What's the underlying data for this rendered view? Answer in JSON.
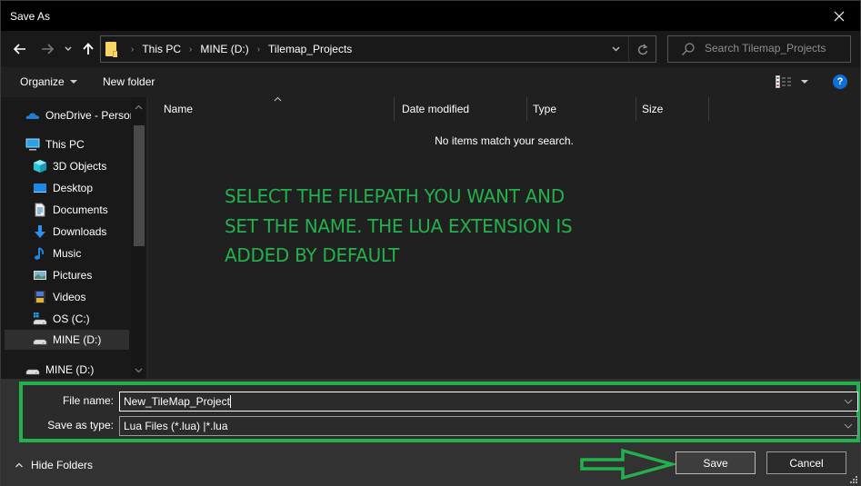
{
  "window": {
    "title": "Save As"
  },
  "nav": {
    "back_icon": "arrow-left-icon",
    "forward_icon": "arrow-right-icon",
    "recent_icon": "chevron-down-icon",
    "up_icon": "arrow-up-icon",
    "breadcrumbs": [
      "This PC",
      "MINE (D:)",
      "Tilemap_Projects"
    ],
    "search_placeholder": "Search Tilemap_Projects"
  },
  "toolbar": {
    "organize_label": "Organize",
    "new_folder_label": "New folder",
    "view_icon": "details-view-icon",
    "help_label": "?"
  },
  "sidebar": {
    "items": [
      {
        "label": "OneDrive - Personal",
        "icon": "onedrive-cloud-icon"
      },
      {
        "label": "This PC",
        "icon": "computer-icon"
      },
      {
        "label": "3D Objects",
        "icon": "3d-objects-icon"
      },
      {
        "label": "Desktop",
        "icon": "desktop-icon"
      },
      {
        "label": "Documents",
        "icon": "documents-icon"
      },
      {
        "label": "Downloads",
        "icon": "downloads-icon"
      },
      {
        "label": "Music",
        "icon": "music-icon"
      },
      {
        "label": "Pictures",
        "icon": "pictures-icon"
      },
      {
        "label": "Videos",
        "icon": "videos-icon"
      },
      {
        "label": "OS (C:)",
        "icon": "drive-c-icon"
      },
      {
        "label": "MINE (D:)",
        "icon": "drive-icon",
        "selected": true
      },
      {
        "label": "MINE (D:)",
        "icon": "drive-icon"
      }
    ]
  },
  "content": {
    "columns": [
      "Name",
      "Date modified",
      "Type",
      "Size"
    ],
    "empty_message": "No items match your search.",
    "annotation_lines": [
      "SELECT THE FILEPATH YOU WANT AND",
      "SET THE NAME. THE LUA EXTENSION IS",
      "ADDED BY DEFAULT"
    ]
  },
  "form": {
    "file_name_label": "File name:",
    "file_name_value": "New_TileMap_Project",
    "save_type_label": "Save as type:",
    "save_type_value": "Lua Files (*.lua) |*.lua"
  },
  "footer": {
    "hide_folders_label": "Hide Folders",
    "save_label": "Save",
    "cancel_label": "Cancel"
  },
  "colors": {
    "annotation_green": "#22b14c",
    "help_blue": "#0e6fd6",
    "folder_yellow": "#f6d565"
  }
}
